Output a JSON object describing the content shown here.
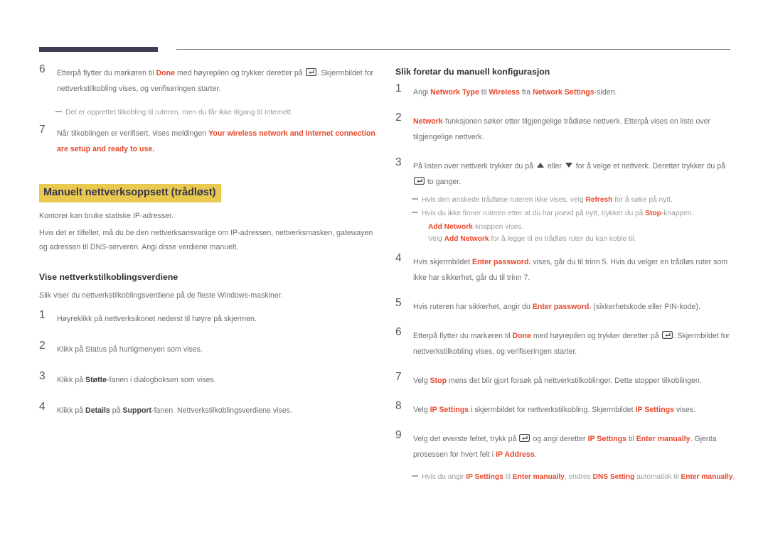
{
  "header": {
    "rule_thick_color": "#443c54",
    "rule_thin_color": "#7a7a80"
  },
  "colors": {
    "keyword_red": "#e8472b",
    "highlight_yellow": "#e9c94f",
    "heading_navy": "#33334d",
    "body_gray": "#6d6e71",
    "note_gray": "#9a9b9e"
  },
  "icons": {
    "enter_key": "enter-key-icon",
    "arrow_up": "arrow-up-icon",
    "arrow_down": "arrow-down-icon",
    "note_dash": "note-dash-icon"
  },
  "left_column": {
    "steps_top": [
      {
        "num": "6",
        "parts": [
          {
            "t": "Etterpå flytter du markøren til ",
            "s": "n"
          },
          {
            "t": "Done",
            "s": "kw"
          },
          {
            "t": " med høyrepilen og trykker deretter på ",
            "s": "n"
          },
          {
            "t": "ENTER_ICON",
            "s": "icon"
          },
          {
            "t": ". Skjermbildet for nettverkstilkobling vises, og verifiseringen starter.",
            "s": "n"
          }
        ],
        "text": "Etterpå flytter du markøren til Done med høyrepilen og trykker deretter på ⏎. Skjermbildet for nettverkstilkobling vises, og verifiseringen starter."
      }
    ],
    "note_1": "Det er opprettet tilkobling til ruteren, men du får ikke tilgang til Internett.",
    "step_7": {
      "num": "7",
      "lead": "Når tilkoblingen er verifisert, vises meldingen ",
      "message": "Your wireless network and Internet connection are setup and ready to use."
    },
    "section_heading": "Manuelt nettverksoppsett (trådløst)",
    "para_1": "Kontorer kan bruke statiske IP-adresser.",
    "para_2": "Hvis det er tilfellet, må du be den nettverksansvarlige om IP-adressen, nettverksmasken, gatewayen og adressen til DNS-serveren. Angi disse verdiene manuelt.",
    "sub_heading": "Vise nettverkstilkoblingsverdiene",
    "para_3": "Slik viser du nettverkstilkoblingsverdiene på de fleste Windows-maskiner.",
    "steps": [
      {
        "num": "1",
        "text": "Høyreklikk på nettverksikonet nederst til høyre på skjermen."
      },
      {
        "num": "2",
        "text": "Klikk på Status på hurtigmenyen som vises."
      },
      {
        "num": "3",
        "pre": "Klikk på ",
        "bold": "Støtte",
        "post": "-fanen i dialogboksen som vises."
      },
      {
        "num": "4",
        "pre": "Klikk på ",
        "bold": "Details",
        "mid": " på ",
        "bold2": "Support",
        "post": "-fanen. Nettverkstilkoblingsverdiene vises."
      }
    ]
  },
  "right_column": {
    "heading": "Slik foretar du manuell konfigurasjon",
    "step_1": {
      "num": "1",
      "p1": "Angi ",
      "k1": "Network Type",
      "p2": " til ",
      "k2": "Wireless",
      "p3": " fra ",
      "k3": "Network Settings",
      "p4": "-siden."
    },
    "step_2": {
      "num": "2",
      "k1": "Network",
      "p1": "-funksjonen søker etter tilgjengelige trådløse nettverk. Etterpå vises en liste over tilgjengelige nettverk."
    },
    "step_3": {
      "num": "3",
      "p1": "På listen over nettverk trykker du på ",
      "p2": " eller ",
      "p3": " for å velge et nettverk. Deretter trykker du på ",
      "p4": " to ganger."
    },
    "note_refresh": {
      "p1": "Hvis den ønskede trådløse ruteren ikke vises, velg ",
      "k1": "Refresh",
      "p2": " for å søke på nytt."
    },
    "note_stop": {
      "p1": "Hvis du ikke finner ruteren etter at du har prøvd på nytt, trykker du på ",
      "k1": "Stop",
      "p2": "-knappen.",
      "l2_k": "Add Network",
      "l2_p": "-knappen vises.",
      "l3_p1": "Velg ",
      "l3_k": "Add Network",
      "l3_p2": " for å legge til en trådløs ruter du kan koble til."
    },
    "step_4": {
      "num": "4",
      "p1": "Hvis skjermbildet ",
      "k1": "Enter password.",
      "p2": " vises, går du til trinn 5. Hvis du velger en trådløs ruter som ikke har sikkerhet, går du til trinn 7."
    },
    "step_5": {
      "num": "5",
      "p1": "Hvis ruteren har sikkerhet, angir du ",
      "k1": "Enter password.",
      "p2": " (sikkerhetskode eller PIN-kode)."
    },
    "step_6": {
      "num": "6",
      "p1": "Etterpå flytter du markøren til ",
      "k1": "Done",
      "p2": " med høyrepilen og trykker deretter på ",
      "p3": ". Skjermbildet for nettverkstilkobling vises, og verifiseringen starter."
    },
    "step_7": {
      "num": "7",
      "p1": "Velg ",
      "k1": "Stop",
      "p2": " mens det blir gjort forsøk på nettverkstilkoblinger. Dette stopper tilkoblingen."
    },
    "step_8": {
      "num": "8",
      "p1": "Velg ",
      "k1": "IP Settings",
      "p2": " i skjermbildet for nettverkstilkobling. Skjermbildet ",
      "k2": "IP Settings",
      "p3": " vises."
    },
    "step_9": {
      "num": "9",
      "p1": "Velg det øverste feltet, trykk på ",
      "p2": " og angi deretter ",
      "k1": "IP Settings",
      "p3": " til ",
      "k2": "Enter manually",
      "p4": ". Gjenta prosessen for hvert felt i ",
      "k3": "IP Address",
      "p5": "."
    },
    "note_dns": {
      "p1": "Hvis du angir ",
      "k1": "IP Settings",
      "p2": " til ",
      "k2": "Enter manually",
      "p3": ", endres ",
      "k3": "DNS Setting",
      "p4": " automatisk til ",
      "k4": "Enter manually",
      "p5": "."
    }
  }
}
